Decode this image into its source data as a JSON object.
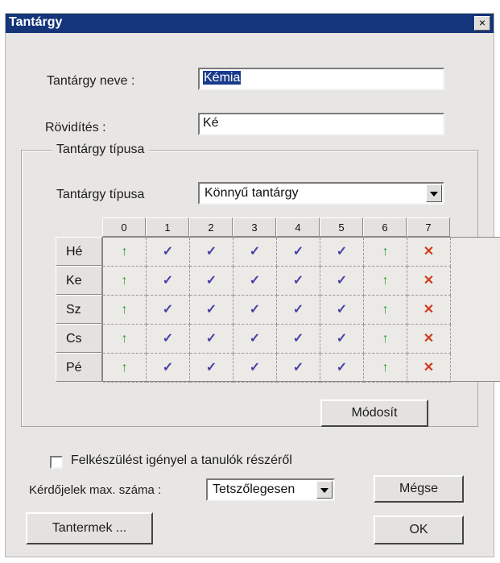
{
  "window": {
    "title": "Tantárgy",
    "close_symbol": "×"
  },
  "fields": {
    "name_label": "Tantárgy neve :",
    "name_value": "Kémia",
    "abbr_label": "Rövidítés :",
    "abbr_value": "Ké"
  },
  "group": {
    "legend": "Tantárgy típusa",
    "type_label": "Tantárgy típusa",
    "type_value": "Könnyű tantárgy"
  },
  "grid": {
    "columns": [
      "0",
      "1",
      "2",
      "3",
      "4",
      "5",
      "6",
      "7"
    ],
    "rows": [
      {
        "label": "Hé",
        "cells": [
          "pin",
          "check",
          "check",
          "check",
          "check",
          "check",
          "pin",
          "x"
        ]
      },
      {
        "label": "Ke",
        "cells": [
          "pin",
          "check",
          "check",
          "check",
          "check",
          "check",
          "pin",
          "x"
        ]
      },
      {
        "label": "Sz",
        "cells": [
          "pin",
          "check",
          "check",
          "check",
          "check",
          "check",
          "pin",
          "x"
        ]
      },
      {
        "label": "Cs",
        "cells": [
          "pin",
          "check",
          "check",
          "check",
          "check",
          "check",
          "pin",
          "x"
        ]
      },
      {
        "label": "Pé",
        "cells": [
          "pin",
          "check",
          "check",
          "check",
          "check",
          "check",
          "pin",
          "x"
        ]
      }
    ],
    "icon_glyphs": {
      "pin": "↑",
      "check": "✓",
      "x": "✕"
    },
    "icon_names": {
      "pin": "pin-icon",
      "check": "check-icon",
      "x": "cross-icon"
    }
  },
  "buttons": {
    "modify": "Módosít",
    "cancel": "Mégse",
    "rooms": "Tantermek ...",
    "ok": "OK"
  },
  "options": {
    "prep_checkbox_label": "Felkészülést igényel a tanulók részéről",
    "prep_checked": false,
    "max_q_label": "Kérdőjelek max. száma :",
    "max_q_value": "Tetszőlegesen"
  },
  "colors": {
    "titlebar": "#14357a",
    "pin": "#2f9a2f",
    "check": "#4a3ea8",
    "x": "#d23a1e"
  }
}
